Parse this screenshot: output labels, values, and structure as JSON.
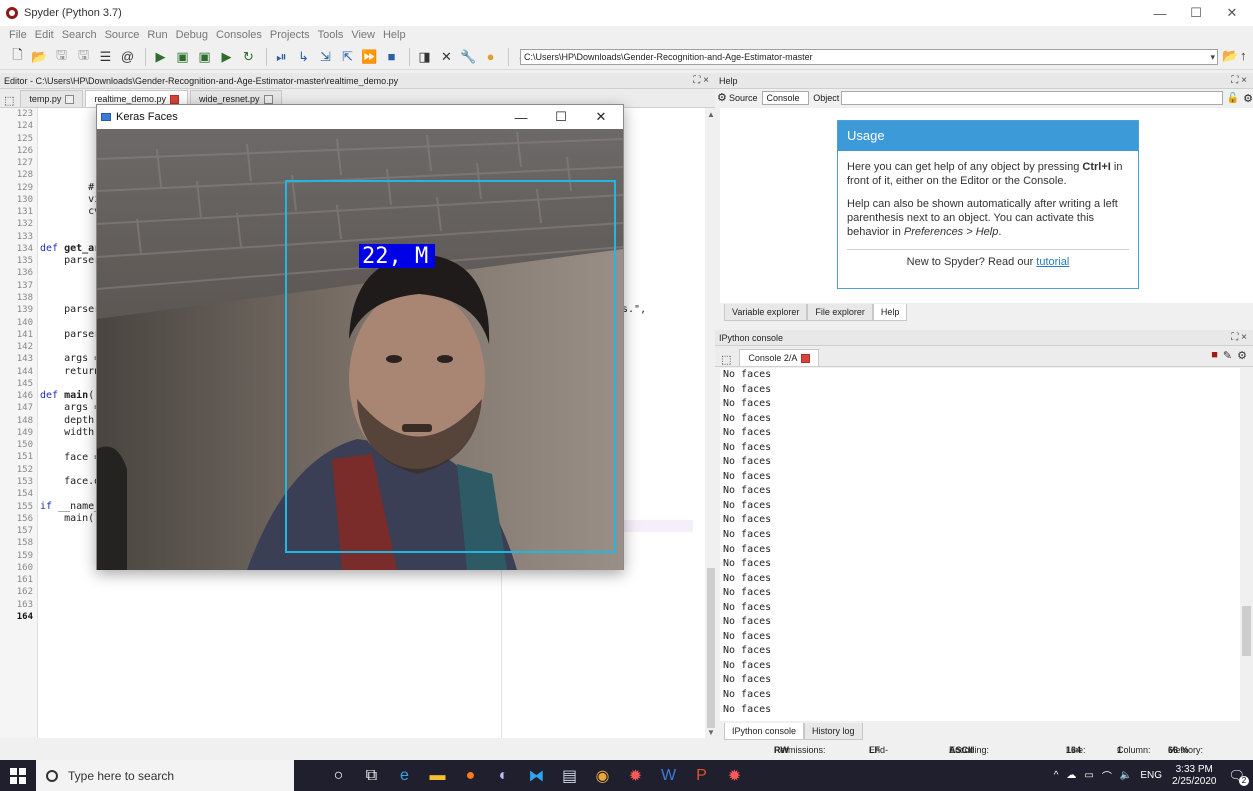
{
  "window": {
    "title": "Spyder (Python 3.7)"
  },
  "menu": [
    "File",
    "Edit",
    "Search",
    "Source",
    "Run",
    "Debug",
    "Consoles",
    "Projects",
    "Tools",
    "View",
    "Help"
  ],
  "toolbar": {
    "path": "C:\\Users\\HP\\Downloads\\Gender-Recognition-and-Age-Estimator-master"
  },
  "editor": {
    "header": "Editor - C:\\Users\\HP\\Downloads\\Gender-Recognition-and-Age-Estimator-master\\realtime_demo.py",
    "tabs": [
      {
        "label": "temp.py"
      },
      {
        "label": "realtime_demo.py"
      },
      {
        "label": "wide_resnet.py"
      }
    ],
    "line_numbers": [
      "123",
      "124",
      "125",
      "126",
      "127",
      "128",
      "129",
      "130",
      "131",
      "132",
      "133",
      "134",
      "135",
      "136",
      "137",
      "138",
      "139",
      "140",
      "141",
      "142",
      "143",
      "144",
      "145",
      "146",
      "147",
      "148",
      "149",
      "150",
      "151",
      "152",
      "153",
      "154",
      "155",
      "156",
      "157",
      "158",
      "159",
      "160",
      "161",
      "162",
      "163",
      "164"
    ],
    "current_line": "164",
    "code": [
      {
        "line": "129",
        "text": "        #"
      },
      {
        "line": "130",
        "text": "        vi"
      },
      {
        "line": "131",
        "text": "        cv"
      },
      {
        "line": "134",
        "text": "def get_ar"
      },
      {
        "line": "135",
        "text": "    parser"
      },
      {
        "line": "139",
        "text": "    parser"
      },
      {
        "line": "141",
        "text": "    parser"
      },
      {
        "line": "143",
        "text": "    args ="
      },
      {
        "line": "144",
        "text": "    return"
      },
      {
        "line": "146",
        "text": "def main()"
      },
      {
        "line": "147",
        "text": "    args ="
      },
      {
        "line": "148",
        "text": "    depth"
      },
      {
        "line": "149",
        "text": "    width"
      },
      {
        "line": "151",
        "text": "    face ="
      },
      {
        "line": "153",
        "text": "    face.d"
      },
      {
        "line": "155",
        "text": "if __name__ == \"__main__\":"
      },
      {
        "line": "156",
        "text": "    main()"
      }
    ],
    "right_fragment": "es.\","
  },
  "help": {
    "header": "Help",
    "source_label": "Source",
    "source_value": "Console",
    "object_label": "Object",
    "usage_title": "Usage",
    "usage_p1_a": "Here you can get help of any object by pressing ",
    "usage_p1_key": "Ctrl+I",
    "usage_p1_b": " in front of it, either on the Editor or the Console.",
    "usage_p2_a": "Help can also be shown automatically after writing a left parenthesis next to an object. You can activate this behavior in ",
    "usage_p2_em": "Preferences > Help",
    "usage_p2_b": ".",
    "new_prefix": "New to Spyder? Read our ",
    "new_link": "tutorial",
    "tabs": [
      "Variable explorer",
      "File explorer",
      "Help"
    ]
  },
  "console": {
    "header": "IPython console",
    "tab_label": "Console 2/A",
    "lines": [
      "No faces",
      "No faces",
      "No faces",
      "No faces",
      "No faces",
      "No faces",
      "No faces",
      "No faces",
      "No faces",
      "No faces",
      "No faces",
      "No faces",
      "No faces",
      "No faces",
      "No faces",
      "No faces",
      "No faces",
      "No faces",
      "No faces",
      "No faces",
      "No faces",
      "No faces",
      "No faces",
      "No faces"
    ],
    "bottom_tabs": [
      "IPython console",
      "History log"
    ]
  },
  "status": {
    "permissions_label": "Permissions:",
    "permissions": "RW",
    "eol_label": "End-of-lines:",
    "eol": "LF",
    "encoding_label": "Encoding:",
    "encoding": "ASCII",
    "line_label": "Line:",
    "line": "164",
    "column_label": "Column:",
    "column": "1",
    "memory_label": "Memory:",
    "memory": "66 %"
  },
  "keras": {
    "title": "Keras Faces",
    "label": "22, M"
  },
  "taskbar": {
    "search_placeholder": "Type here to search",
    "lang": "ENG",
    "time": "3:33 PM",
    "date": "2/25/2020",
    "notif_count": "2"
  },
  "colors": {
    "accent": "#3d9ad9",
    "detect_box": "#22b6e6",
    "label_bg": "#0000e6",
    "taskbar": "#1f1f2e"
  }
}
